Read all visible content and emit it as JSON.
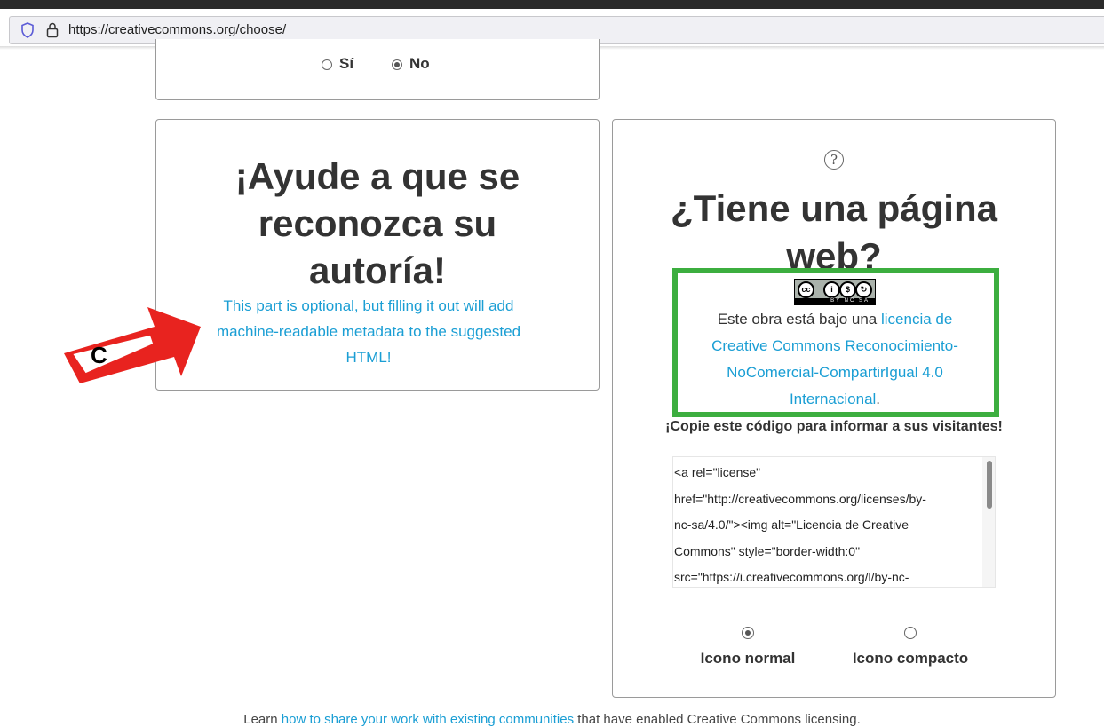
{
  "browser": {
    "url": "https://creativecommons.org/choose/"
  },
  "top_card": {
    "option_yes": "Sí",
    "option_no": "No",
    "selected": "No"
  },
  "left_card": {
    "title_line1": "¡Ayude a que se",
    "title_line2": "reconozca su",
    "title_line3": "autoría!",
    "note": "This part is optional, but filling it out will add machine-readable metadata to the suggested HTML!"
  },
  "right_card": {
    "help_icon": "?",
    "title_line1": "¿Tiene una página",
    "title_line2": "web?",
    "badge_text": "BY NC SA",
    "license_prefix": "Este obra está bajo una ",
    "license_link": "licencia de Creative Commons Reconocimiento-NoComercial-CompartirIgual 4.0 Internacional",
    "license_suffix": ".",
    "copy_heading": "¡Copie este código para informar a sus visitantes!",
    "code_lines": [
      "<a rel=\"license\"",
      "href=\"http://creativecommons.org/licenses/by-",
      "nc-sa/4.0/\"><img alt=\"Licencia de Creative",
      "Commons\" style=\"border-width:0\"",
      "src=\"https://i.creativecommons.org/l/by-nc-"
    ],
    "icon_normal": "Icono normal",
    "icon_compact": "Icono compacto",
    "selected_icon": "Icono normal"
  },
  "footer": {
    "prefix": "Learn ",
    "link": "how to share your work with existing communities",
    "suffix": " that have enabled Creative Commons licensing."
  },
  "annotation": {
    "label": "C",
    "arrow_color": "#e8231f"
  }
}
